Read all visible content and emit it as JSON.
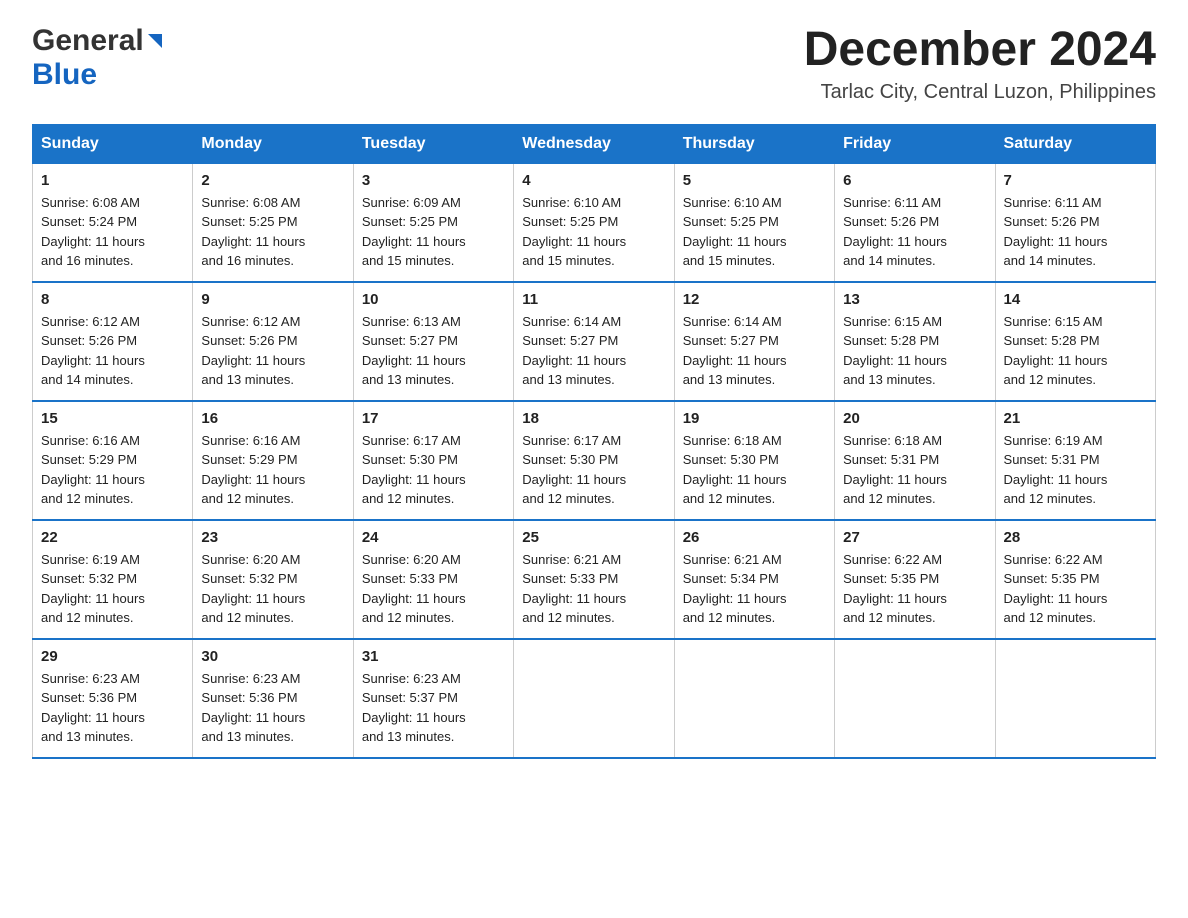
{
  "header": {
    "logo_general": "General",
    "logo_blue": "Blue",
    "month_title": "December 2024",
    "subtitle": "Tarlac City, Central Luzon, Philippines"
  },
  "days_of_week": [
    "Sunday",
    "Monday",
    "Tuesday",
    "Wednesday",
    "Thursday",
    "Friday",
    "Saturday"
  ],
  "weeks": [
    [
      {
        "day": "1",
        "sunrise": "6:08 AM",
        "sunset": "5:24 PM",
        "daylight": "11 hours and 16 minutes."
      },
      {
        "day": "2",
        "sunrise": "6:08 AM",
        "sunset": "5:25 PM",
        "daylight": "11 hours and 16 minutes."
      },
      {
        "day": "3",
        "sunrise": "6:09 AM",
        "sunset": "5:25 PM",
        "daylight": "11 hours and 15 minutes."
      },
      {
        "day": "4",
        "sunrise": "6:10 AM",
        "sunset": "5:25 PM",
        "daylight": "11 hours and 15 minutes."
      },
      {
        "day": "5",
        "sunrise": "6:10 AM",
        "sunset": "5:25 PM",
        "daylight": "11 hours and 15 minutes."
      },
      {
        "day": "6",
        "sunrise": "6:11 AM",
        "sunset": "5:26 PM",
        "daylight": "11 hours and 14 minutes."
      },
      {
        "day": "7",
        "sunrise": "6:11 AM",
        "sunset": "5:26 PM",
        "daylight": "11 hours and 14 minutes."
      }
    ],
    [
      {
        "day": "8",
        "sunrise": "6:12 AM",
        "sunset": "5:26 PM",
        "daylight": "11 hours and 14 minutes."
      },
      {
        "day": "9",
        "sunrise": "6:12 AM",
        "sunset": "5:26 PM",
        "daylight": "11 hours and 13 minutes."
      },
      {
        "day": "10",
        "sunrise": "6:13 AM",
        "sunset": "5:27 PM",
        "daylight": "11 hours and 13 minutes."
      },
      {
        "day": "11",
        "sunrise": "6:14 AM",
        "sunset": "5:27 PM",
        "daylight": "11 hours and 13 minutes."
      },
      {
        "day": "12",
        "sunrise": "6:14 AM",
        "sunset": "5:27 PM",
        "daylight": "11 hours and 13 minutes."
      },
      {
        "day": "13",
        "sunrise": "6:15 AM",
        "sunset": "5:28 PM",
        "daylight": "11 hours and 13 minutes."
      },
      {
        "day": "14",
        "sunrise": "6:15 AM",
        "sunset": "5:28 PM",
        "daylight": "11 hours and 12 minutes."
      }
    ],
    [
      {
        "day": "15",
        "sunrise": "6:16 AM",
        "sunset": "5:29 PM",
        "daylight": "11 hours and 12 minutes."
      },
      {
        "day": "16",
        "sunrise": "6:16 AM",
        "sunset": "5:29 PM",
        "daylight": "11 hours and 12 minutes."
      },
      {
        "day": "17",
        "sunrise": "6:17 AM",
        "sunset": "5:30 PM",
        "daylight": "11 hours and 12 minutes."
      },
      {
        "day": "18",
        "sunrise": "6:17 AM",
        "sunset": "5:30 PM",
        "daylight": "11 hours and 12 minutes."
      },
      {
        "day": "19",
        "sunrise": "6:18 AM",
        "sunset": "5:30 PM",
        "daylight": "11 hours and 12 minutes."
      },
      {
        "day": "20",
        "sunrise": "6:18 AM",
        "sunset": "5:31 PM",
        "daylight": "11 hours and 12 minutes."
      },
      {
        "day": "21",
        "sunrise": "6:19 AM",
        "sunset": "5:31 PM",
        "daylight": "11 hours and 12 minutes."
      }
    ],
    [
      {
        "day": "22",
        "sunrise": "6:19 AM",
        "sunset": "5:32 PM",
        "daylight": "11 hours and 12 minutes."
      },
      {
        "day": "23",
        "sunrise": "6:20 AM",
        "sunset": "5:32 PM",
        "daylight": "11 hours and 12 minutes."
      },
      {
        "day": "24",
        "sunrise": "6:20 AM",
        "sunset": "5:33 PM",
        "daylight": "11 hours and 12 minutes."
      },
      {
        "day": "25",
        "sunrise": "6:21 AM",
        "sunset": "5:33 PM",
        "daylight": "11 hours and 12 minutes."
      },
      {
        "day": "26",
        "sunrise": "6:21 AM",
        "sunset": "5:34 PM",
        "daylight": "11 hours and 12 minutes."
      },
      {
        "day": "27",
        "sunrise": "6:22 AM",
        "sunset": "5:35 PM",
        "daylight": "11 hours and 12 minutes."
      },
      {
        "day": "28",
        "sunrise": "6:22 AM",
        "sunset": "5:35 PM",
        "daylight": "11 hours and 12 minutes."
      }
    ],
    [
      {
        "day": "29",
        "sunrise": "6:23 AM",
        "sunset": "5:36 PM",
        "daylight": "11 hours and 13 minutes."
      },
      {
        "day": "30",
        "sunrise": "6:23 AM",
        "sunset": "5:36 PM",
        "daylight": "11 hours and 13 minutes."
      },
      {
        "day": "31",
        "sunrise": "6:23 AM",
        "sunset": "5:37 PM",
        "daylight": "11 hours and 13 minutes."
      },
      null,
      null,
      null,
      null
    ]
  ],
  "labels": {
    "sunrise": "Sunrise:",
    "sunset": "Sunset:",
    "daylight": "Daylight:"
  }
}
